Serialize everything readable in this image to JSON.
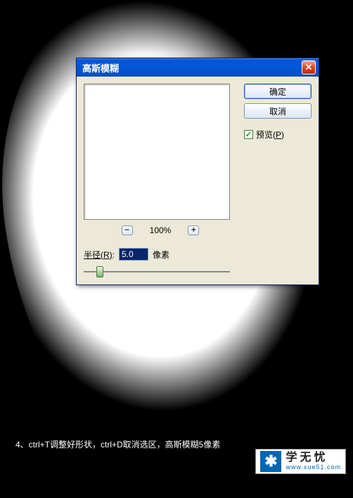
{
  "caption": "4、ctrl+T调整好形状，ctrl+D取消选区，高斯模糊5像素",
  "watermark": {
    "main": "学无忧",
    "sub": "www.xue51.com"
  },
  "dialog": {
    "title": "高斯模糊",
    "ok_label": "确定",
    "cancel_label": "取消",
    "preview_label": "预览(P)",
    "zoom_value": "100%",
    "radius_label": "半径(R):",
    "radius_value": "5.0",
    "radius_unit": "像素"
  }
}
